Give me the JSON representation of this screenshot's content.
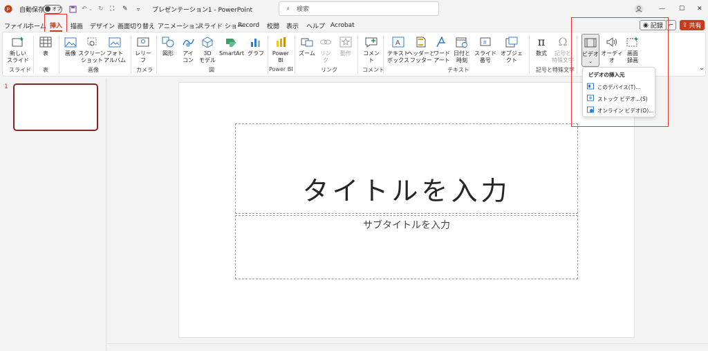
{
  "titlebar": {
    "autosave_label": "自動保存",
    "autosave_state": "オフ",
    "doc_title": "プレゼンテーション1 - PowerPoint",
    "search_placeholder": "検索"
  },
  "menu": {
    "tabs": [
      "ファイル",
      "ホーム",
      "挿入",
      "描画",
      "デザイン",
      "画面切り替え",
      "アニメーション",
      "スライド ショー",
      "Record",
      "校閲",
      "表示",
      "ヘルプ",
      "Acrobat"
    ],
    "active": "挿入",
    "record_button": "記録",
    "share_button": "共有"
  },
  "ribbon": {
    "new_slide": "新しい\nスライド",
    "table": "表",
    "image": "画像",
    "screenshot": "スクリーン\nショット",
    "photo_album": "フォト\nアルバム",
    "cameo": "レリー\nフ",
    "shapes": "図形",
    "icons": "アイ\nコン",
    "model3d": "3D\nモデル",
    "smartart": "SmartArt",
    "graph": "グラフ",
    "powerbi": "Power\nBI",
    "zoom": "ズーム",
    "link": "リンク",
    "action": "動作",
    "comment": "コメント",
    "textbox": "テキスト\nボックス",
    "header_footer": "ヘッダーと\nフッター",
    "wordart": "ワード\nアート",
    "datetime": "日付と\n時刻",
    "slide_number": "スライド番号",
    "object": "オブジェクト",
    "equation": "数式",
    "symbol": "記号と\n特殊文字",
    "video": "ビデオ",
    "audio": "オーディオ",
    "screen_record": "画面\n録画",
    "groups": {
      "slides": "スライド",
      "tables": "表",
      "images": "画像",
      "camera": "カメラ",
      "illustrations": "図",
      "powerbi": "Power BI",
      "links": "リンク",
      "comments": "コメント",
      "text": "テキスト",
      "symbols": "記号と特殊文字"
    }
  },
  "dropdown": {
    "header": "ビデオの挿入元",
    "items": [
      "このデバイス(T)...",
      "ストック ビデオ...(S)",
      "オンライン ビデオ(O)..."
    ]
  },
  "slides": {
    "number": "1",
    "title_placeholder": "タイトルを入力",
    "subtitle_placeholder": "サブタイトルを入力"
  },
  "colors": {
    "accent": "#c43e1c",
    "highlight": "#ee3333"
  }
}
